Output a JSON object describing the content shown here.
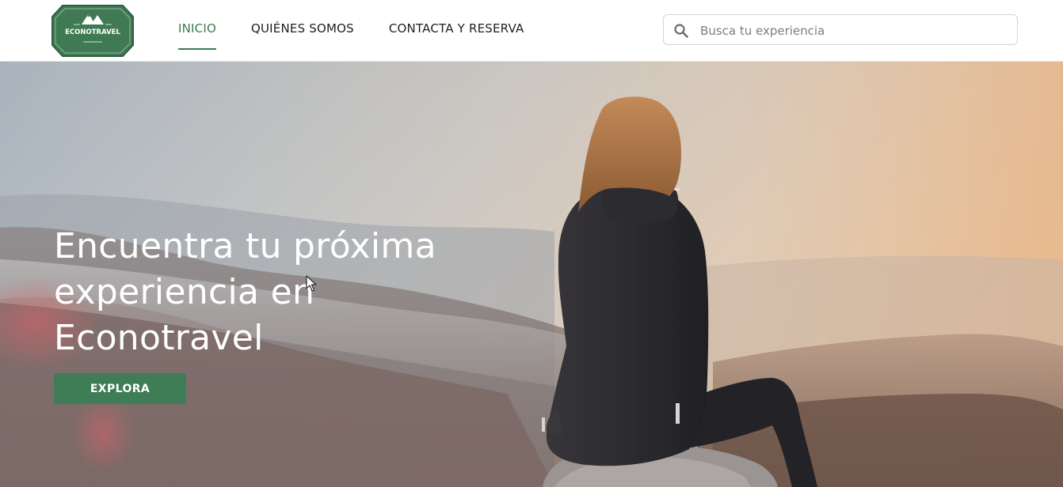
{
  "header": {
    "logo_text": "ECONOTRAVEL",
    "nav": [
      {
        "label": "INICIO",
        "active": true
      },
      {
        "label": "QUIÉNES SOMOS",
        "active": false
      },
      {
        "label": "CONTACTA Y RESERVA",
        "active": false
      }
    ],
    "search": {
      "placeholder": "Busca tu experiencia",
      "value": ""
    }
  },
  "hero": {
    "title_lines": [
      "Encuentra tu próxima",
      "experiencia en",
      "Econotravel"
    ],
    "cta_label": "EXPLORA"
  },
  "colors": {
    "brand_green": "#3e7d55",
    "nav_active": "#3a7a52",
    "logo_fill": "#3f7a54"
  },
  "icons": {
    "search": "search-icon",
    "logo": "mountain-logo-icon",
    "cursor": "mouse-cursor-icon"
  }
}
